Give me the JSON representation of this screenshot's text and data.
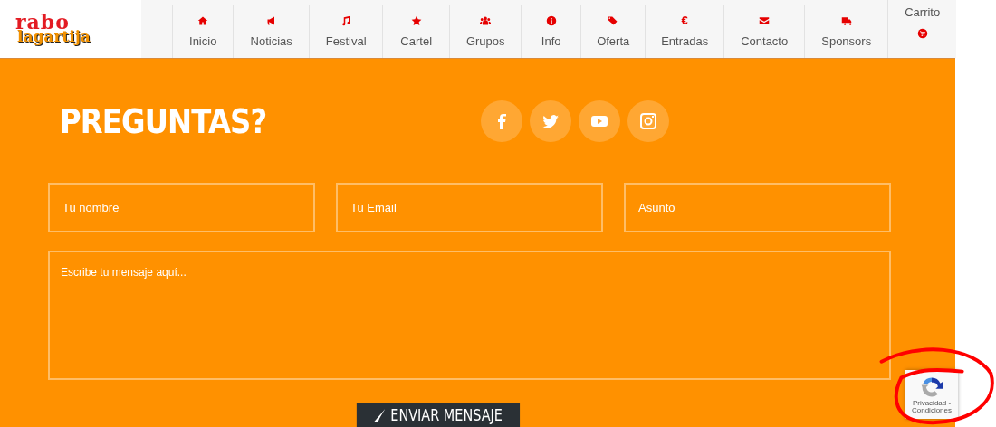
{
  "logo": {
    "top": "rabo",
    "bottom": "lagartija"
  },
  "nav": [
    {
      "kind": "link",
      "label": "Inicio"
    },
    {
      "kind": "link",
      "label": "Noticias"
    },
    {
      "kind": "link",
      "label": "Festival"
    },
    {
      "kind": "link",
      "label": "Cartel"
    },
    {
      "kind": "link",
      "label": "Grupos"
    },
    {
      "kind": "link",
      "label": "Info"
    },
    {
      "kind": "link",
      "label": "Oferta"
    },
    {
      "kind": "link",
      "glyph": "€",
      "label": "Entradas"
    },
    {
      "kind": "link",
      "label": "Contacto"
    },
    {
      "kind": "link",
      "label": "Sponsors"
    },
    {
      "kind": "cart",
      "label": "Carrito"
    }
  ],
  "contact": {
    "title": "PREGUNTAS?",
    "fields": [
      {
        "placeholder": "Tu nombre"
      },
      {
        "placeholder": "Tu Email"
      },
      {
        "placeholder": "Asunto"
      }
    ],
    "message": {
      "placeholder": "Escribe tu mensaje aquí..."
    },
    "send_button": "ENVIAR MENSAJE"
  },
  "recaptcha": {
    "text": "Privacidad - Condiciones"
  }
}
